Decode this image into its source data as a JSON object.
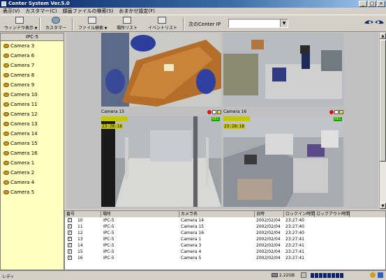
{
  "window": {
    "title": "Center System Ver.5.0"
  },
  "menu": [
    "表示(V)",
    "カスタマー(C)",
    "録画ファイルの検索(S)",
    "おまかせ設定(F)"
  ],
  "toolbar": {
    "buttons": [
      {
        "label": "ウィンドウ表示",
        "icon": "window-icon"
      },
      {
        "label": "カスタマー",
        "icon": "customer-icon"
      },
      {
        "label": "ファイル検索",
        "icon": "file-search-icon"
      },
      {
        "label": "場所リスト",
        "icon": "location-list-icon"
      },
      {
        "label": "イベントリスト",
        "icon": "event-list-icon"
      }
    ],
    "next_center_label": "次のCenter IP",
    "next_center_value": ""
  },
  "sidebar": {
    "header": "IPC-5",
    "items": [
      "Camera 3",
      "Camera 6",
      "Camera 7",
      "Camera 8",
      "Camera 9",
      "Camera 10",
      "Camera 11",
      "Camera 12",
      "Camera 13",
      "Camera 14",
      "Camera 15",
      "Camera 16",
      "Camera 1",
      "Camera 2",
      "Camera 4",
      "Camera 5"
    ]
  },
  "videos": [
    {
      "name": "",
      "date": "",
      "time": "",
      "rec": ""
    },
    {
      "name": "",
      "date": "",
      "time": "",
      "rec": ""
    },
    {
      "name": "Camera 15",
      "date": "2002/02/04",
      "time": "23:28:18",
      "rec": "REC"
    },
    {
      "name": "Camera 16",
      "date": "2002/02/04",
      "time": "23:28:18",
      "rec": "REC"
    }
  ],
  "list": {
    "columns": [
      "番号",
      "場所",
      "カメラ名",
      "日時",
      "ロックイン時間",
      "ロックアウト時間"
    ],
    "rows": [
      {
        "no": "10",
        "place": "IPC-5",
        "camera": "Camera 14",
        "date": "2002/02/04",
        "time": "23:27:40"
      },
      {
        "no": "11",
        "place": "IPC-5",
        "camera": "Camera 15",
        "date": "2002/02/04",
        "time": "23:27:40"
      },
      {
        "no": "12",
        "place": "IPC-5",
        "camera": "Camera 16",
        "date": "2002/02/04",
        "time": "23:27:40"
      },
      {
        "no": "13",
        "place": "IPC-5",
        "camera": "Camera 1",
        "date": "2002/02/04",
        "time": "23:27:41"
      },
      {
        "no": "14",
        "place": "IPC-5",
        "camera": "Camera 3",
        "date": "2002/02/04",
        "time": "23:27:41"
      },
      {
        "no": "15",
        "place": "IPC-5",
        "camera": "Camera 4",
        "date": "2002/02/04",
        "time": "23:27:41"
      },
      {
        "no": "16",
        "place": "IPC-5",
        "camera": "Camera 5",
        "date": "2002/02/04",
        "time": "23:27:41"
      }
    ]
  },
  "status": {
    "text": "レディ",
    "disk": "2.22GB"
  }
}
